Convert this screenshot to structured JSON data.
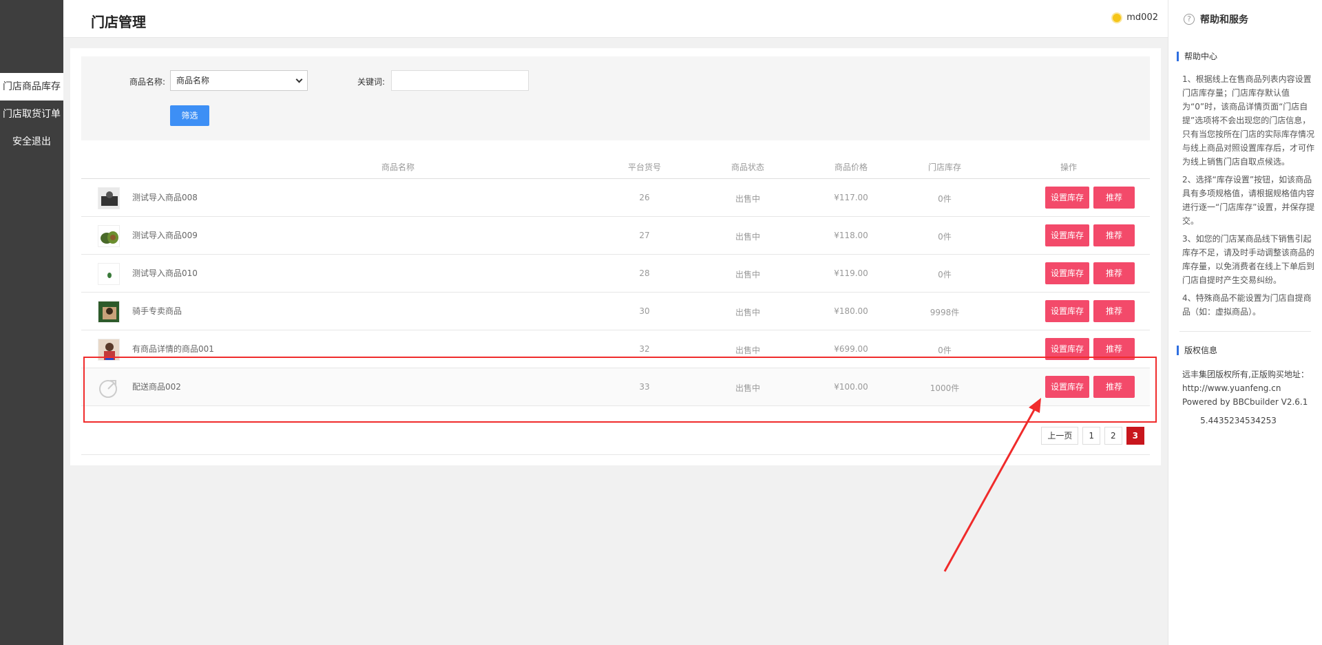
{
  "sidebar": {
    "items": [
      {
        "label": "门店商品库存",
        "active": true
      },
      {
        "label": "门店取货订单",
        "active": false
      },
      {
        "label": "安全退出",
        "active": false
      }
    ]
  },
  "header": {
    "title": "门店管理",
    "username": "md002"
  },
  "filter": {
    "product_label": "商品名称:",
    "product_select_value": "商品名称",
    "keyword_label": "关键词:",
    "keyword_value": "",
    "filter_button": "筛选"
  },
  "table": {
    "headers": [
      "商品名称",
      "平台货号",
      "商品状态",
      "商品价格",
      "门店库存",
      "操作"
    ],
    "rows": [
      {
        "name": "测试导入商品008",
        "sku": "26",
        "status": "出售中",
        "price": "¥117.00",
        "stock": "0件",
        "btn_stock": "设置库存",
        "btn_recommend": "推荐"
      },
      {
        "name": "测试导入商品009",
        "sku": "27",
        "status": "出售中",
        "price": "¥118.00",
        "stock": "0件",
        "btn_stock": "设置库存",
        "btn_recommend": "推荐"
      },
      {
        "name": "测试导入商品010",
        "sku": "28",
        "status": "出售中",
        "price": "¥119.00",
        "stock": "0件",
        "btn_stock": "设置库存",
        "btn_recommend": "推荐"
      },
      {
        "name": "骑手专卖商品",
        "sku": "30",
        "status": "出售中",
        "price": "¥180.00",
        "stock": "9998件",
        "btn_stock": "设置库存",
        "btn_recommend": "推荐"
      },
      {
        "name": "有商品详情的商品001",
        "sku": "32",
        "status": "出售中",
        "price": "¥699.00",
        "stock": "0件",
        "btn_stock": "设置库存",
        "btn_recommend": "推荐"
      },
      {
        "name": "配送商品002",
        "sku": "33",
        "status": "出售中",
        "price": "¥100.00",
        "stock": "1000件",
        "btn_stock": "设置库存",
        "btn_recommend": "推荐"
      }
    ]
  },
  "pagination": {
    "prev": "上一页",
    "pages": [
      "1",
      "2",
      "3"
    ],
    "current": "3"
  },
  "help": {
    "title": "帮助和服务",
    "center_title": "帮助中心",
    "items": [
      "1、根据线上在售商品列表内容设置门店库存量；门店库存默认值为“0”时，该商品详情页面“门店自提”选项将不会出现您的门店信息，只有当您按所在门店的实际库存情况与线上商品对照设置库存后，才可作为线上销售门店自取点候选。",
      "2、选择“库存设置”按钮，如该商品具有多项规格值，请根据规格值内容进行逐一“门店库存”设置，并保存提交。",
      "3、如您的门店某商品线下销售引起库存不足，请及时手动调整该商品的库存量，以免消费者在线上下单后到门店自提时产生交易纠纷。",
      "4、特殊商品不能设置为门店自提商品（如：虚拟商品）。"
    ],
    "copyright_title": "版权信息",
    "copyright_text": "远丰集团版权所有,正版购买地址：http://www.yuanfeng.cn",
    "powered": "Powered by BBCbuilder V2.6.1",
    "version_num": "5.4435234534253"
  },
  "colors": {
    "sidebar_bg": "#3e3e3e",
    "primary_blue": "#3d8ff5",
    "action_red": "#f34a6a",
    "page_active": "#c8161d",
    "annotation_red": "#f02b2b"
  }
}
